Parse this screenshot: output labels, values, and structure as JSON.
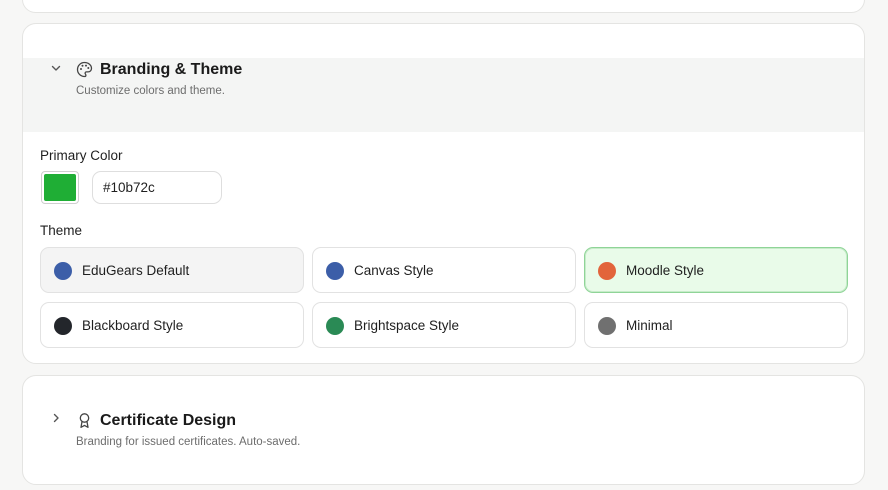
{
  "branding": {
    "title": "Branding & Theme",
    "subtitle": "Customize colors and theme.",
    "expanded": true,
    "chevron_icon": "chevron-down-icon",
    "section_icon": "palette-icon",
    "primary_color": {
      "label": "Primary Color",
      "value": "#10b72c",
      "swatch_color": "#1fae35"
    },
    "theme": {
      "label": "Theme",
      "selected": "Moodle Style",
      "options": [
        {
          "label": "EduGears Default",
          "color": "#3c5ea8"
        },
        {
          "label": "Canvas Style",
          "color": "#3c5ea8"
        },
        {
          "label": "Moodle Style",
          "color": "#e2643b"
        },
        {
          "label": "Blackboard Style",
          "color": "#23262b"
        },
        {
          "label": "Brightspace Style",
          "color": "#2a8a55"
        },
        {
          "label": "Minimal",
          "color": "#707070"
        }
      ]
    }
  },
  "certificate": {
    "title": "Certificate Design",
    "subtitle": "Branding for issued certificates. Auto-saved.",
    "expanded": false,
    "chevron_icon": "chevron-right-icon",
    "section_icon": "award-icon"
  },
  "colors": {
    "accent": "#10b72c",
    "selected_bg": "#e9fbe9",
    "selected_border": "#8fd497"
  }
}
